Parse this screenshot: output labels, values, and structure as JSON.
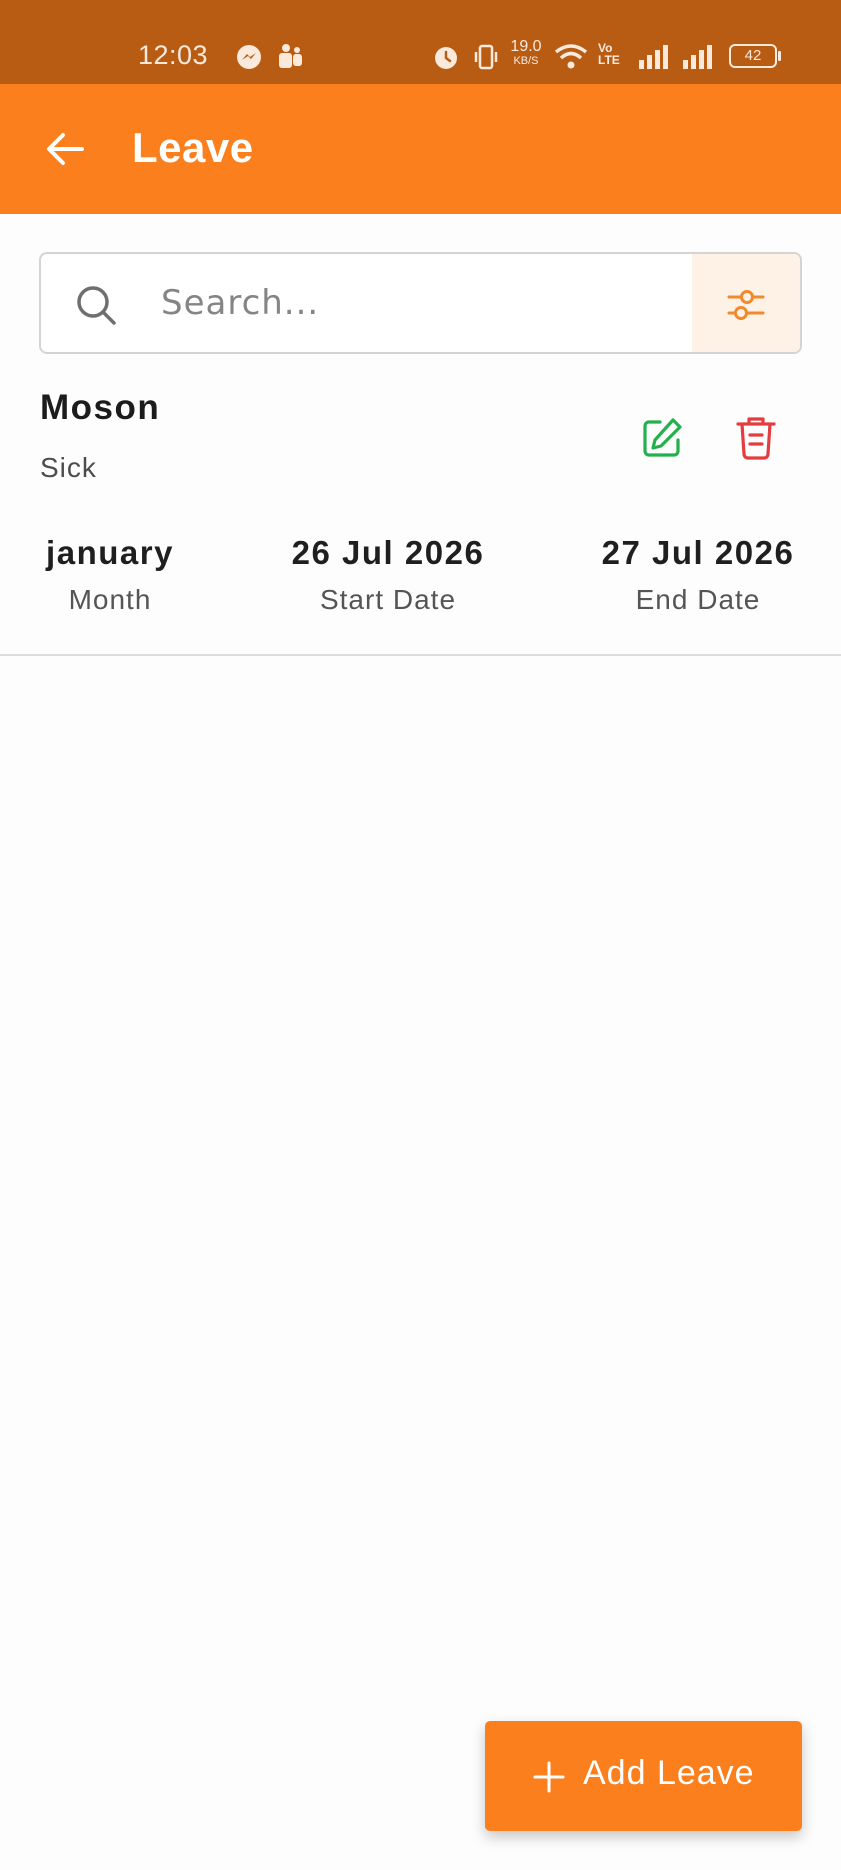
{
  "status_bar": {
    "time": "12:03",
    "net_speed_value": "19.0",
    "net_speed_unit": "KB/S",
    "volte_top": "Vo",
    "volte_bottom": "LTE",
    "battery": "42"
  },
  "app_bar": {
    "title": "Leave",
    "back_icon": "arrow-left-icon",
    "background": "#fb801d"
  },
  "search": {
    "placeholder": "Search...",
    "value": "",
    "icon": "search-icon",
    "filter_icon": "sliders-icon"
  },
  "leave_list": [
    {
      "name": "Moson",
      "type": "Sick",
      "month_value": "january",
      "month_label": "Month",
      "start_value": "26 Jul 2026",
      "start_label": "Start Date",
      "end_value": "27 Jul 2026",
      "end_label": "End Date",
      "edit_color": "#22b14c",
      "delete_color": "#e43d40"
    }
  ],
  "fab": {
    "label": "Add Leave",
    "icon": "plus-icon"
  }
}
